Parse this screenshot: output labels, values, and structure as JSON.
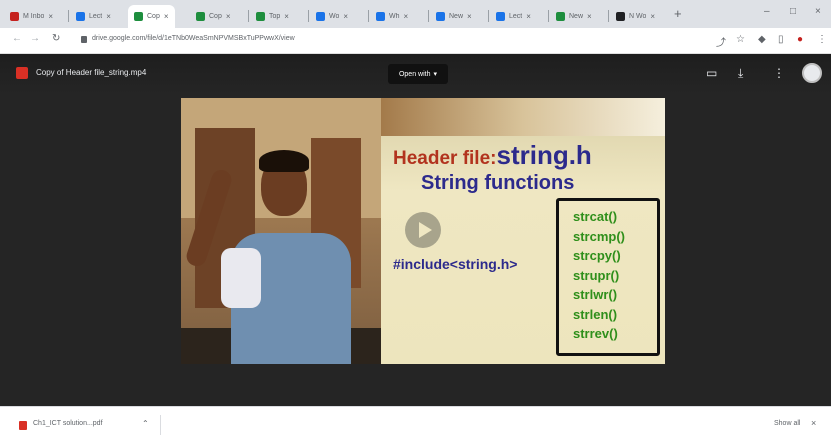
{
  "browser": {
    "tabs": [
      {
        "label": "M Inbo",
        "color": "#c5221f"
      },
      {
        "label": "Lect",
        "color": "#1a73e8"
      },
      {
        "label": "Cop",
        "color": "#1e8e3e",
        "active": true
      },
      {
        "label": "Cop",
        "color": "#1e8e3e"
      },
      {
        "label": "Top",
        "color": "#1e8e3e"
      },
      {
        "label": "Wo",
        "color": "#1a73e8"
      },
      {
        "label": "Wh",
        "color": "#1a73e8"
      },
      {
        "label": "New",
        "color": "#1a73e8"
      },
      {
        "label": "Lect",
        "color": "#1a73e8"
      },
      {
        "label": "New",
        "color": "#1e8e3e"
      },
      {
        "label": "N Wo",
        "color": "#202124"
      }
    ],
    "new_tab": "+",
    "url": "drive.google.com/file/d/1eTNb0WeaSmNPVMSBxTuPPwwX/view"
  },
  "viewer": {
    "file_title": "Copy of Header file_string.mp4",
    "open_with": "Open with",
    "avatar_initial": ""
  },
  "slide": {
    "title_prefix": "Header file:",
    "title_main": "string.h",
    "subtitle": "String functions",
    "include": "#include<string.h>",
    "functions": [
      "strcat()",
      "strcmp()",
      "strcpy()",
      "strupr()",
      "strlwr()",
      "strlen()",
      "strrev()"
    ]
  },
  "downloads": {
    "file_name": "Ch1_ICT solution...pdf",
    "show_all": "Show all"
  }
}
